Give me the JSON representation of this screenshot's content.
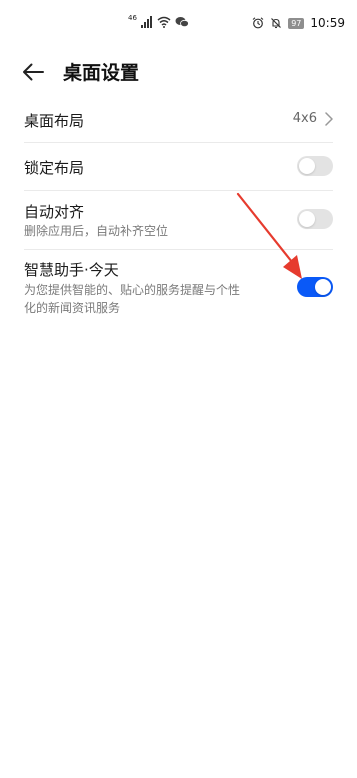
{
  "status_bar": {
    "network_text": "46",
    "battery": "97",
    "time": "10:59"
  },
  "header": {
    "title": "桌面设置",
    "back_icon": "arrow-left-icon"
  },
  "settings": {
    "layout": {
      "label": "桌面布局",
      "value": "4x6"
    },
    "lock_layout": {
      "label": "锁定布局",
      "enabled": false
    },
    "auto_align": {
      "label": "自动对齐",
      "description": "删除应用后，自动补齐空位",
      "enabled": false
    },
    "smart_assistant": {
      "label": "智慧助手·今天",
      "description_line1": "为您提供智能的、贴心的服务提醒与个性",
      "description_line2": "化的新闻资讯服务",
      "enabled": true
    }
  },
  "colors": {
    "accent": "#0a59f7",
    "toggle_off": "#e3e3e3",
    "annotation_arrow": "#e63b2e"
  }
}
